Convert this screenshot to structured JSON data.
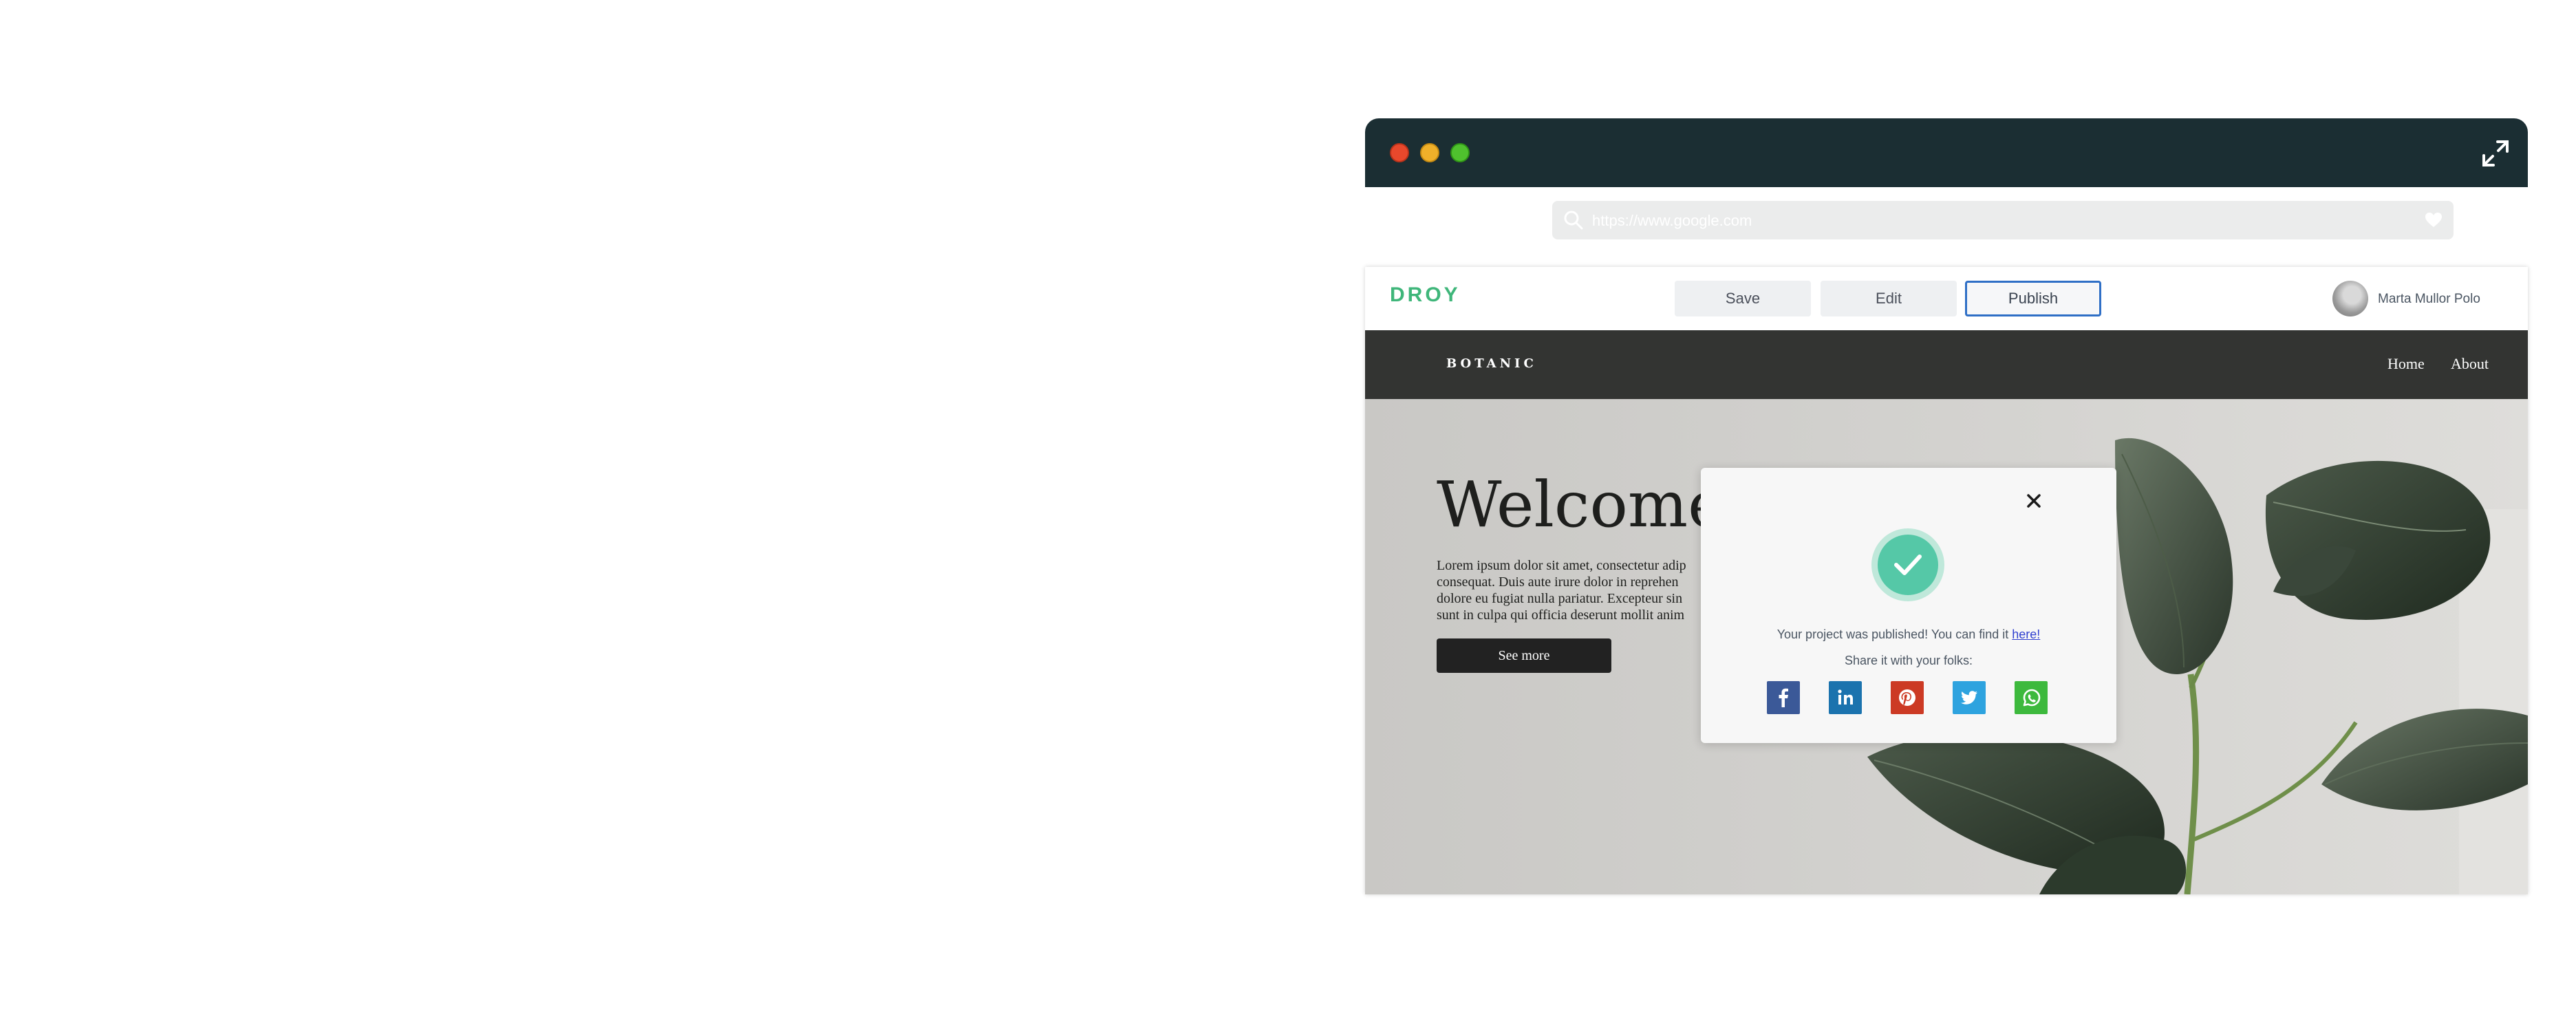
{
  "browser": {
    "address_url": "https://www.google.com"
  },
  "editor": {
    "logo": "DROY",
    "save_label": "Save",
    "edit_label": "Edit",
    "publish_label": "Publish",
    "user_name": "Marta Mullor Polo"
  },
  "site": {
    "brand": "BOTANIC",
    "nav": [
      "Home",
      "About"
    ],
    "hero_title": "Welcome",
    "hero_lines": [
      "Lorem ipsum dolor sit amet, consectetur adip",
      "consequat. Duis aute irure dolor in reprehen",
      "dolore eu fugiat nulla pariatur. Excepteur sin",
      "sunt in culpa qui officia deserunt mollit anim"
    ],
    "cta_label": "See more"
  },
  "modal": {
    "message_prefix": "Your project was published! You can find it ",
    "message_link": "here!",
    "share_prompt": "Share it with your folks:",
    "share_icons": [
      "facebook-icon",
      "linkedin-icon",
      "pinterest-icon",
      "twitter-icon",
      "whatsapp-icon"
    ]
  },
  "colors": {
    "titlebar": "#1b2e33",
    "brand_green": "#3fb67a",
    "publish_border": "#2f6fc6",
    "success": "#55c8a7",
    "site_nav": "#333432"
  }
}
